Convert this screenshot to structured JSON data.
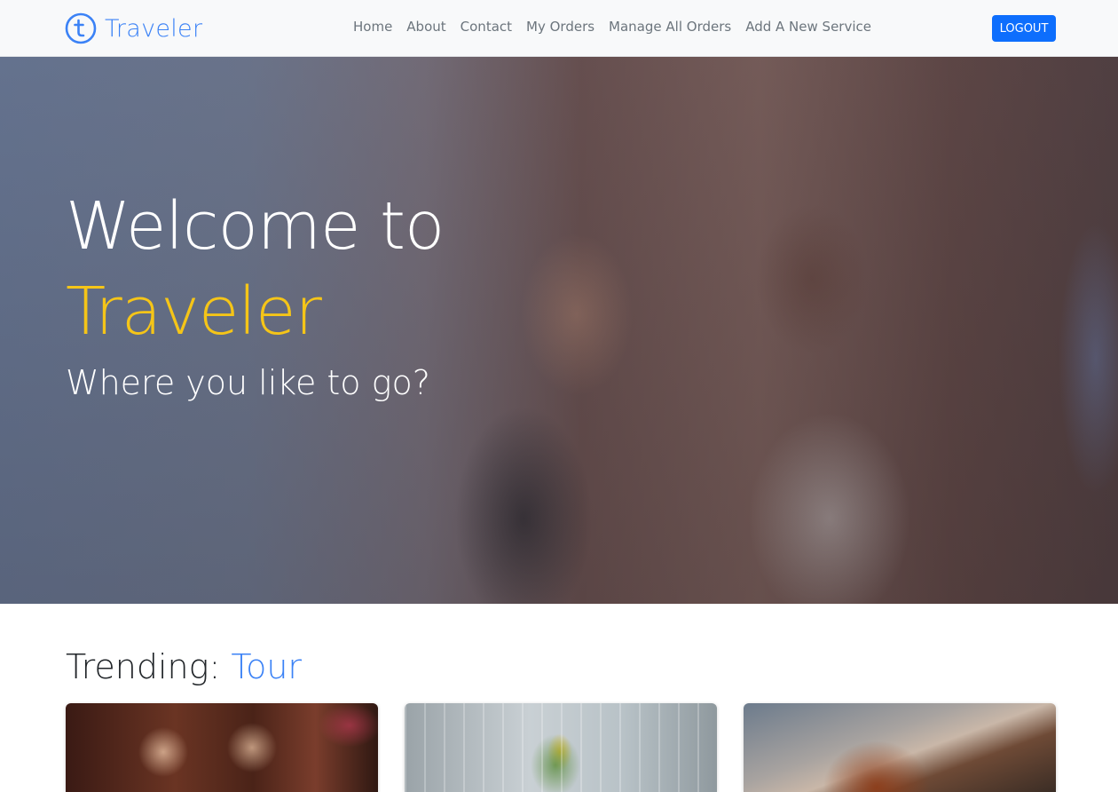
{
  "brand": {
    "name": "Traveler",
    "icon": "traveler-logo-icon",
    "color": "#3b82f6"
  },
  "nav": {
    "links": [
      "Home",
      "About",
      "Contact",
      "My Orders",
      "Manage All Orders",
      "Add A New Service"
    ],
    "logout_label": "LOGOUT"
  },
  "hero": {
    "title": "Welcome to",
    "brand": "Traveler",
    "subtitle": "Where you like to go?",
    "brand_color": "#f5c518"
  },
  "trending": {
    "prefix": "Trending:",
    "accent": "Tour"
  },
  "colors": {
    "primary": "#0d6efd",
    "accent": "#3b82f6",
    "highlight": "#f5c518"
  }
}
